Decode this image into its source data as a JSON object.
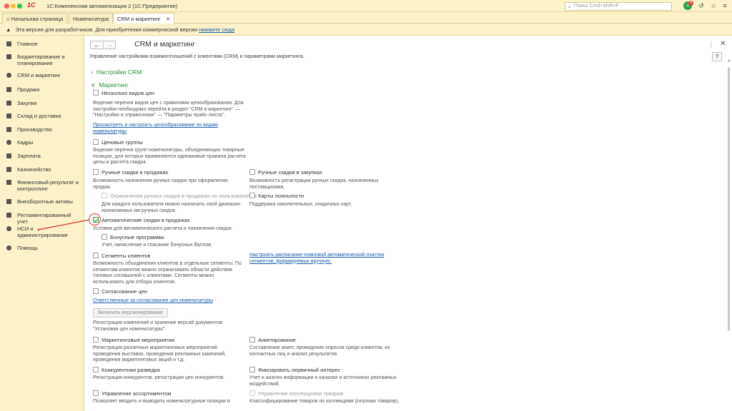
{
  "window": {
    "title": "1С:Комплексная автоматизация 2  (1С:Предприятие)",
    "logo": "1С",
    "search_placeholder": "Поиск Cmd+Shift+F",
    "notification_count": "4"
  },
  "tabs": [
    {
      "label": "Начальная страница"
    },
    {
      "label": "Номенклатура"
    },
    {
      "label": "CRM и маркетинг"
    }
  ],
  "infobar": {
    "text": "Эта версия для разработчиков. Для приобретения коммерческой версии",
    "link": "нажмите сюда"
  },
  "sidebar": {
    "items": [
      {
        "label": "Главное"
      },
      {
        "label": "Бюджетирование и планирование"
      },
      {
        "label": "CRM и маркетинг"
      },
      {
        "label": "Продажи"
      },
      {
        "label": "Закупки"
      },
      {
        "label": "Склад и доставка"
      },
      {
        "label": "Производство"
      },
      {
        "label": "Кадры"
      },
      {
        "label": "Зарплата"
      },
      {
        "label": "Казначейство"
      },
      {
        "label": "Финансовый результат и контроллинг"
      },
      {
        "label": "Внеоборотные активы"
      },
      {
        "label": "Регламентированный учет"
      },
      {
        "label": "НСИ и администрирование"
      },
      {
        "label": "Помощь"
      }
    ]
  },
  "page": {
    "title": "CRM и маркетинг",
    "description": "Управление настройками взаимоотношений с клиентами (CRM) и параметрами маркетинга.",
    "help": "?"
  },
  "sections": {
    "crm_settings": "Настройки CRM",
    "marketing": "Маркетинг"
  },
  "options": {
    "multiple_prices": {
      "label": "Несколько видов цен",
      "note": "Ведение перечня видов цен с правилами ценообразования. Для настройки необходимо перейти в раздел \"CRM и маркетинг\" — \"Настройки и справочники\" — \"Параметры прайс-листа\".",
      "link": "Просмотреть и настроить ценообразование по видам номенклатуры"
    },
    "price_groups": {
      "label": "Ценовые группы",
      "note": "Ведение перечня групп номенклатуры, объединяющих товарные позиции, для которых применяются одинаковые правила расчета цены и расчета скидок."
    },
    "manual_discounts_sales": {
      "label": "Ручные скидки в продажах",
      "note": "Возможность назначения ручных скидок при оформлении продаж."
    },
    "manual_discounts_purchases": {
      "label": "Ручные скидки в закупках",
      "note": "Возможность регистрации ручных скидок, назначенных поставщиками."
    },
    "manual_limits": {
      "label": "Ограничения ручных скидок в продажах по пользователям",
      "note": "Для каждого пользователя можно назначить свой диапазон назначаемых им ручных скидок."
    },
    "loyalty_cards": {
      "label": "Карты лояльности",
      "note": "Поддержка накопительных, скидочных карт."
    },
    "auto_discounts": {
      "label": "Автоматические скидки в продажах",
      "note": "Условия для автоматического расчета и назначения скидок."
    },
    "bonus_programs": {
      "label": "Бонусные программы",
      "note": "Учет, начисление и списание бонусных баллов."
    },
    "client_segments": {
      "label": "Сегменты клиентов",
      "note": "Возможность объединения клиентов в отдельные сегменты. По сегментам клиентов можно ограничивать области действия типовых соглашений с клиентами. Сегменты можно использовать для отбора клиентов.",
      "link": "Настроить расписание плановой автоматической очистки сегментов, формируемых вручную."
    },
    "price_approval": {
      "label": "Согласование цен",
      "link": "Ответственные за согласование цен номенклатуры",
      "button": "Включить версионирование",
      "note": "Регистрация изменений и хранение версий документов \"Установки цен номенклатуры\"."
    },
    "marketing_events": {
      "label": "Маркетинговые мероприятия",
      "note": "Регистрация различных маркетинговых мероприятий: проведения выставок, проведения рекламных кампаний, проведения маркетинговых акций и т.д."
    },
    "surveys": {
      "label": "Анкетирование",
      "note": "Составление анкет, проведение опросов среди клиентов, их контактных лиц и анализ результатов."
    },
    "competitive": {
      "label": "Конкурентная разведка",
      "note": "Регистрация конкурентов, регистрация цен конкурентов."
    },
    "primary_interest": {
      "label": "Фиксировать первичный интерес",
      "note": "Учет и анализ информации о каналах и источниках рекламных воздействий."
    },
    "assortment": {
      "label": "Управление ассортиментом",
      "note": "Позволяет вводить и выводить номенклатурные позиции в"
    },
    "collections": {
      "label": "Управление коллекциями товаров",
      "note": "Классифицирование товаров по коллекциям (сезонам товаров),"
    }
  },
  "colors": {
    "accent_green": "#2d8f3a",
    "panel_yellow": "#fbf2c7",
    "link_blue": "#1a5cb0",
    "annotation_red": "#e0302a"
  }
}
